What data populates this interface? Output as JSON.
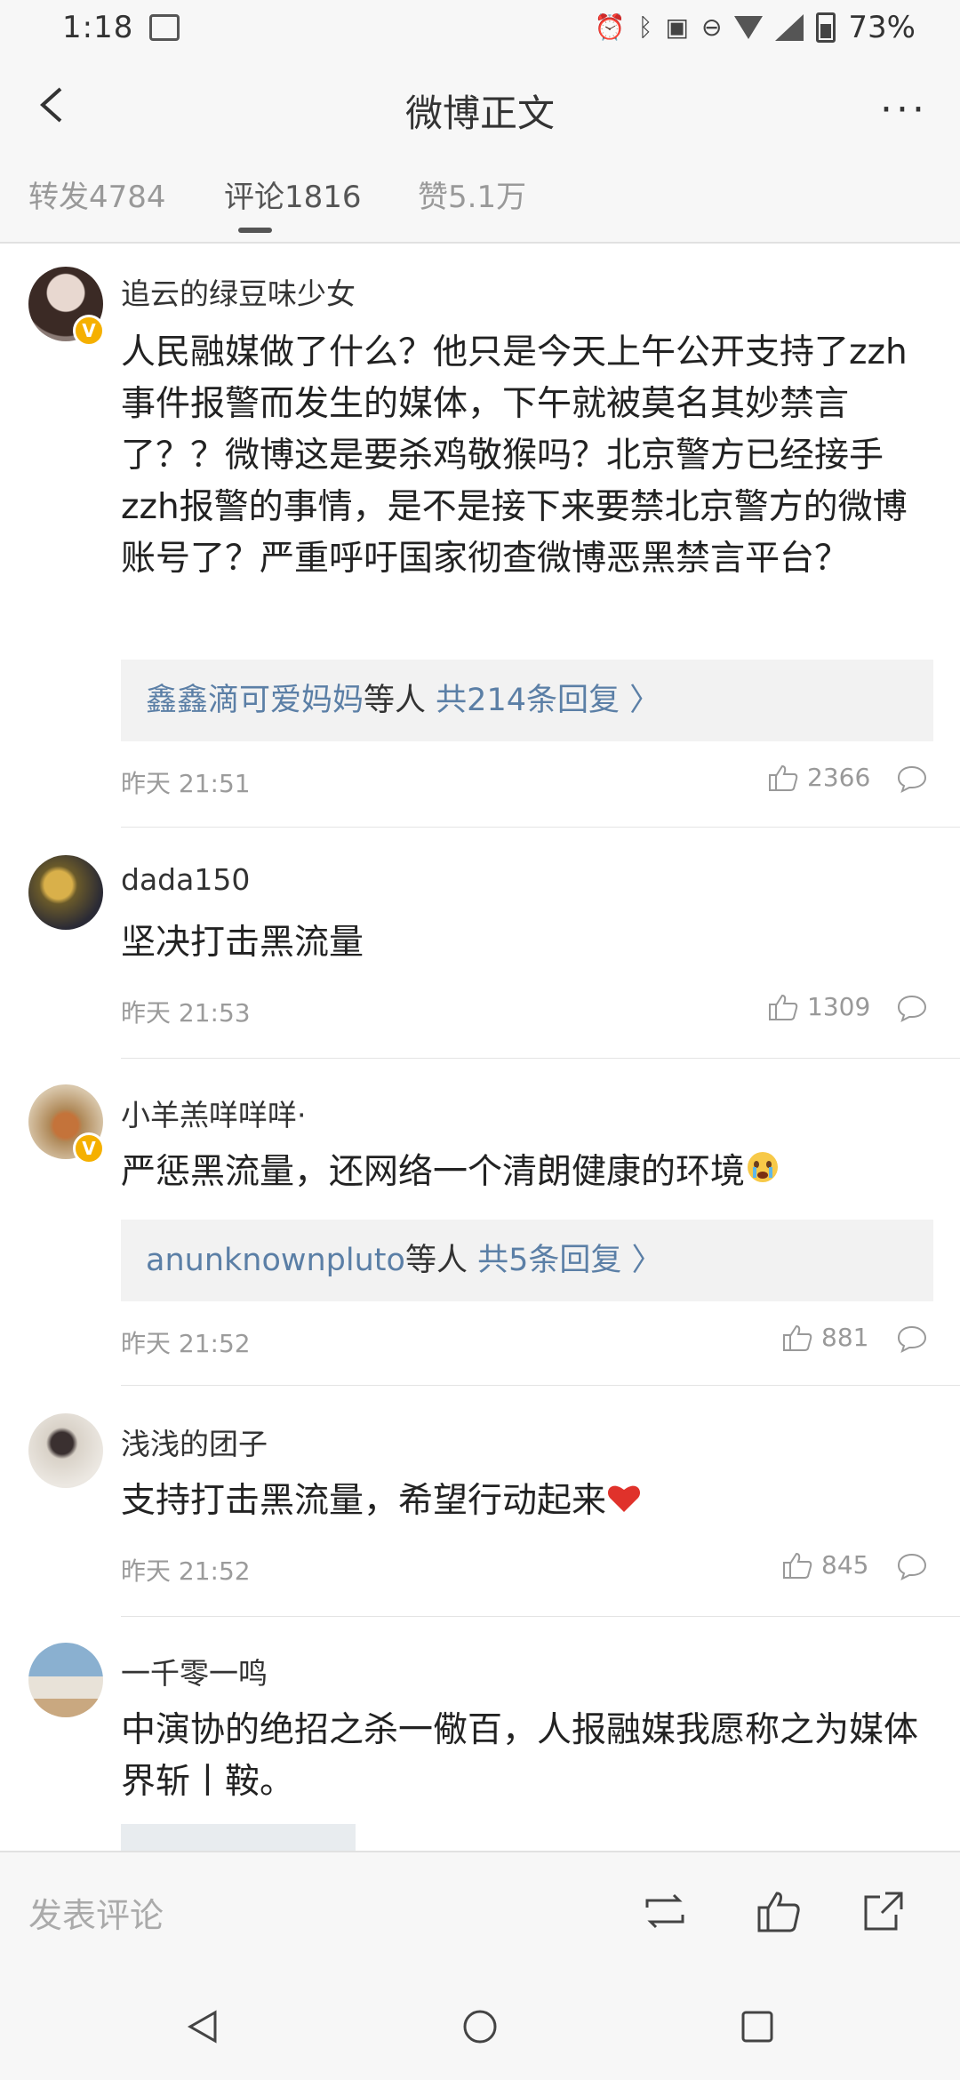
{
  "status_bar": {
    "time": "1:18",
    "battery": "73%"
  },
  "nav": {
    "title": "微博正文"
  },
  "tabs": [
    {
      "label": "转发4784",
      "active": false
    },
    {
      "label": "评论1816",
      "active": true
    },
    {
      "label": "赞5.1万",
      "active": false
    }
  ],
  "comments": [
    {
      "name": "追云的绿豆味少女",
      "text": "人民融媒做了什么？他只是今天上午公开支持了zzh事件报警而发生的媒体，下午就被莫名其妙禁言了？？微博这是要杀鸡敬猴吗？北京警方已经接手zzh报警的事情，是不是接下来要禁北京警方的微博账号了？严重呼吁国家彻查微博恶黑禁言平台？",
      "reply_user": "鑫鑫滴可爱妈妈",
      "reply_mid": "等人",
      "reply_count": "共214条回复",
      "time": "昨天 21:51",
      "likes": "2366"
    },
    {
      "name": "dada150",
      "text": "坚决打击黑流量",
      "time": "昨天 21:53",
      "likes": "1309"
    },
    {
      "name": "小羊羔咩咩咩·",
      "text": "严惩黑流量，还网络一个清朗健康的环境",
      "reply_user": "anunknownpluto",
      "reply_mid": "等人",
      "reply_count": "共5条回复",
      "time": "昨天 21:52",
      "likes": "881"
    },
    {
      "name": "浅浅的团子",
      "text": "支持打击黑流量，希望行动起来",
      "time": "昨天 21:52",
      "likes": "845"
    },
    {
      "name": "一千零一鸣",
      "text": "中演协的绝招之杀一儆百，人报融媒我愿称之为媒体界斩丨鞍。"
    }
  ],
  "bottom_bar": {
    "input_placeholder": "发表评论"
  },
  "colors": {
    "link": "#5b7fa6",
    "badge": "#f5b000"
  }
}
